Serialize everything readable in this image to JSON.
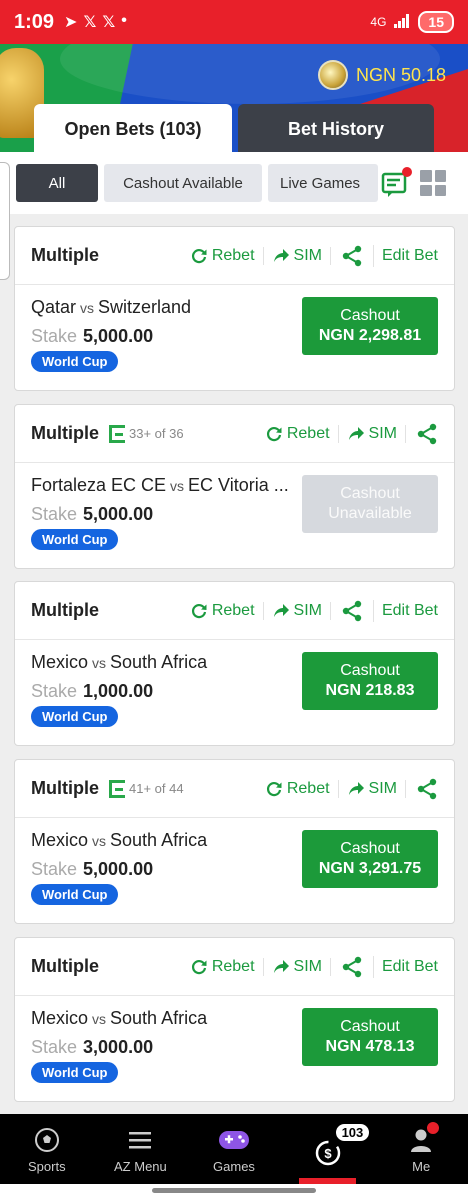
{
  "status_bar": {
    "time": "1:09",
    "left_icons": [
      "telegram-icon",
      "x-icon",
      "x-icon",
      "dot"
    ],
    "network": "4G",
    "battery": "15"
  },
  "header": {
    "balance": "NGN 50.18"
  },
  "tabs": [
    {
      "label": "Open Bets (103)",
      "active": true
    },
    {
      "label": "Bet History",
      "active": false
    }
  ],
  "filters": [
    {
      "label": "All",
      "active": true
    },
    {
      "label": "Cashout Available",
      "active": false
    },
    {
      "label": "Live Games",
      "active": false
    }
  ],
  "bets": [
    {
      "type": "Multiple",
      "badge": null,
      "actions": [
        "Rebet",
        "SIM",
        "share",
        "Edit Bet"
      ],
      "home": "Qatar",
      "vs": "vs",
      "away": "Switzerland",
      "stake_label": "Stake",
      "stake": "5,000.00",
      "tag": "World Cup",
      "cashout_l1": "Cashout",
      "cashout_l2": "NGN 2,298.81",
      "cashout_available": true
    },
    {
      "type": "Multiple",
      "badge": "33+ of 36",
      "actions": [
        "Rebet",
        "SIM",
        "share"
      ],
      "home": "Fortaleza EC CE",
      "vs": "vs",
      "away": "EC Vitoria ...",
      "stake_label": "Stake",
      "stake": "5,000.00",
      "tag": "World Cup",
      "cashout_l1": "Cashout",
      "cashout_l2": "Unavailable",
      "cashout_available": false
    },
    {
      "type": "Multiple",
      "badge": null,
      "actions": [
        "Rebet",
        "SIM",
        "share",
        "Edit Bet"
      ],
      "home": "Mexico",
      "vs": "vs",
      "away": "South Africa",
      "stake_label": "Stake",
      "stake": "1,000.00",
      "tag": "World Cup",
      "cashout_l1": "Cashout",
      "cashout_l2": "NGN 218.83",
      "cashout_available": true
    },
    {
      "type": "Multiple",
      "badge": "41+ of 44",
      "actions": [
        "Rebet",
        "SIM",
        "share"
      ],
      "home": "Mexico",
      "vs": "vs",
      "away": "South Africa",
      "stake_label": "Stake",
      "stake": "5,000.00",
      "tag": "World Cup",
      "cashout_l1": "Cashout",
      "cashout_l2": "NGN 3,291.75",
      "cashout_available": true
    },
    {
      "type": "Multiple",
      "badge": null,
      "actions": [
        "Rebet",
        "SIM",
        "share",
        "Edit Bet"
      ],
      "home": "Mexico",
      "vs": "vs",
      "away": "South Africa",
      "stake_label": "Stake",
      "stake": "3,000.00",
      "tag": "World Cup",
      "cashout_l1": "Cashout",
      "cashout_l2": "NGN 478.13",
      "cashout_available": true
    }
  ],
  "action_labels": {
    "rebet": "Rebet",
    "sim": "SIM",
    "edit": "Edit Bet"
  },
  "bottom_nav": [
    {
      "label": "Sports",
      "icon": "soccer-ball-icon"
    },
    {
      "label": "AZ Menu",
      "icon": "hamburger-menu-icon"
    },
    {
      "label": "Games",
      "icon": "gamepad-icon"
    },
    {
      "label": "",
      "icon": "open-bets-icon",
      "badge": "103",
      "active": true
    },
    {
      "label": "Me",
      "icon": "user-icon"
    }
  ],
  "colors": {
    "brand_red": "#e8202a",
    "cashout_green": "#1c9a3a",
    "tag_blue": "#1565e0",
    "dark_tab": "#3c4048"
  }
}
